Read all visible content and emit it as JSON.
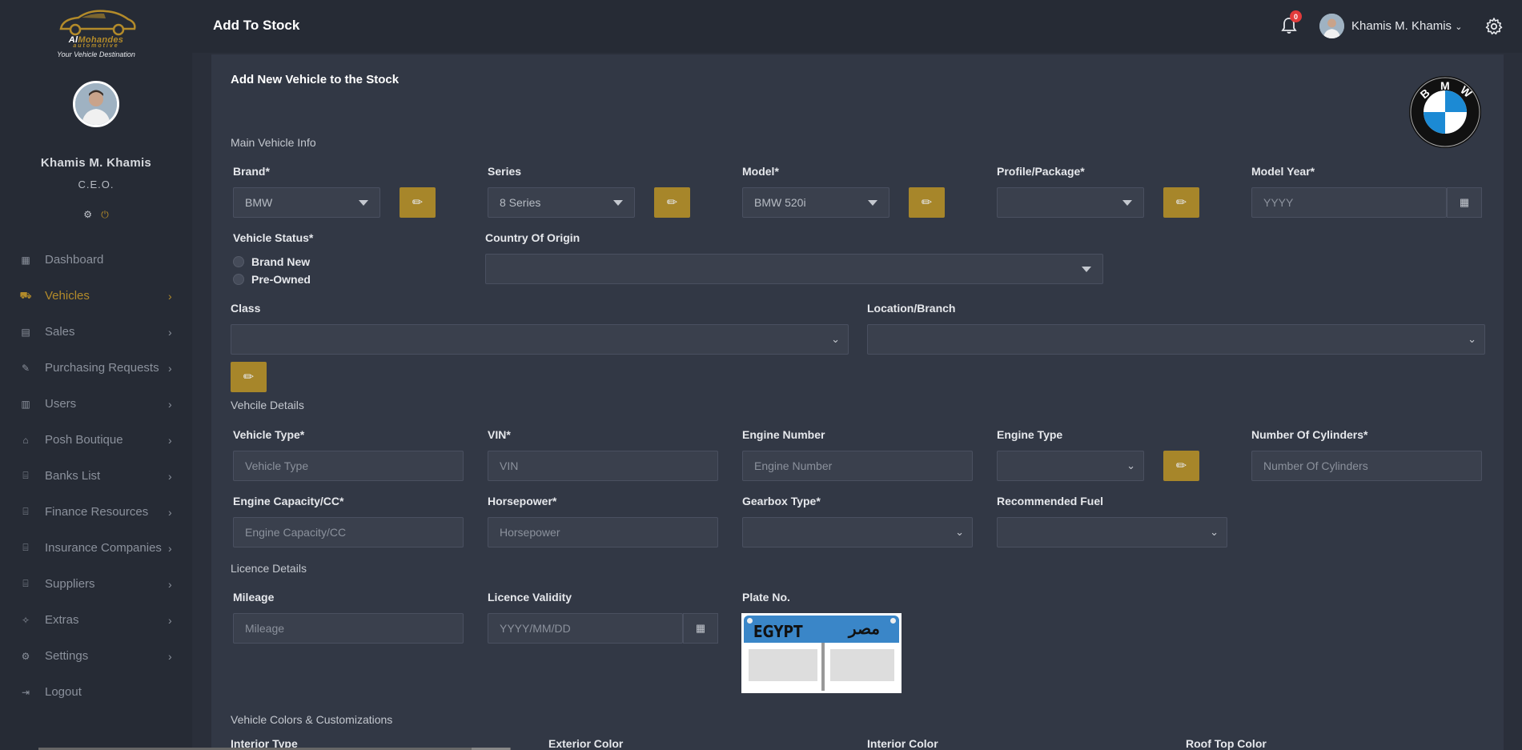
{
  "brand": {
    "name_pre": "Al",
    "name_hl": "Mohandes",
    "sub": "automotive",
    "tagline": "Your Vehicle Destination"
  },
  "sidebar": {
    "user_name": "Khamis M. Khamis",
    "user_role": "C.E.O.",
    "items": [
      {
        "label": "Dashboard",
        "icon": "dashboard-icon"
      },
      {
        "label": "Vehicles",
        "icon": "car-icon",
        "active": true
      },
      {
        "label": "Sales",
        "icon": "sales-icon"
      },
      {
        "label": "Purchasing Requests",
        "icon": "request-icon"
      },
      {
        "label": "Users",
        "icon": "users-icon"
      },
      {
        "label": "Posh Boutique",
        "icon": "boutique-icon"
      },
      {
        "label": "Banks List",
        "icon": "bank-icon"
      },
      {
        "label": "Finance Resources",
        "icon": "finance-icon"
      },
      {
        "label": "Insurance Companies",
        "icon": "insurance-icon"
      },
      {
        "label": "Suppliers",
        "icon": "suppliers-icon"
      },
      {
        "label": "Extras",
        "icon": "extras-icon"
      },
      {
        "label": "Settings",
        "icon": "settings-icon"
      },
      {
        "label": "Logout",
        "icon": "logout-icon"
      }
    ]
  },
  "header": {
    "title": "Add To Stock",
    "notification_count": "0",
    "user_name": "Khamis M. Khamis"
  },
  "colors": {
    "accent": "#a7862a",
    "sidebar_bg": "#262b35",
    "card_bg": "#323845",
    "badge": "#e23b3b"
  },
  "form": {
    "title": "Add New Vehicle to the Stock",
    "sections": {
      "main": "Main Vehicle Info",
      "details": "Vehcile Details",
      "licence": "Licence Details",
      "colors": "Vehicle Colors & Customizations"
    },
    "labels": {
      "brand": "Brand*",
      "series": "Series",
      "model": "Model*",
      "profile": "Profile/Package*",
      "model_year": "Model Year*",
      "vehicle_status": "Vehicle Status*",
      "country": "Country Of Origin",
      "class": "Class",
      "location": "Location/Branch",
      "vehicle_type": "Vehicle Type*",
      "vin": "VIN*",
      "engine_number": "Engine Number",
      "engine_type": "Engine Type",
      "cylinders": "Number Of Cylinders*",
      "engine_capacity": "Engine Capacity/CC*",
      "horsepower": "Horsepower*",
      "gearbox": "Gearbox Type*",
      "fuel": "Recommended Fuel",
      "mileage": "Mileage",
      "licence_validity": "Licence Validity",
      "plate": "Plate No.",
      "interior_type": "Interior Type",
      "exterior_color": "Exterior Color",
      "interior_color": "Interior Color",
      "roof_color": "Roof Top Color"
    },
    "values": {
      "brand": "BMW",
      "series": "8 Series",
      "model": "BMW 520i"
    },
    "placeholders": {
      "model_year": "YYYY",
      "vehicle_type": "Vehicle Type",
      "vin": "VIN",
      "engine_number": "Engine Number",
      "cylinders": "Number Of Cylinders",
      "engine_capacity": "Engine Capacity/CC",
      "horsepower": "Horsepower",
      "mileage": "Mileage",
      "licence_validity": "YYYY/MM/DD"
    },
    "status_options": [
      "Brand New",
      "Pre-Owned"
    ],
    "plate": {
      "left": "EGYPT",
      "right": "مصر"
    }
  }
}
